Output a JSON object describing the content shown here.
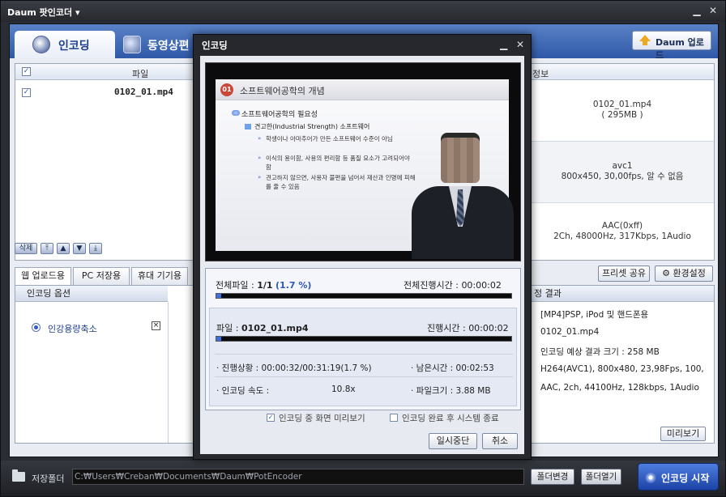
{
  "app": {
    "title": "Daum 팟인코더",
    "title_caret": "▾",
    "min_glyph": "▁",
    "close_glyph": "✕"
  },
  "tabs": {
    "encoding": "인코딩",
    "video_edit": "동영상편"
  },
  "upload_button": "Daum 업로드",
  "file_list": {
    "header_file": "파일",
    "header_info": "정보",
    "row_checked": true,
    "row_file": "0102_01.mp4",
    "info_file_name": "0102_01.mp4",
    "info_file_size": "( 295MB )",
    "info_video_codec": "avc1",
    "info_video_detail": "800x450, 30,00fps, 알 수 없음",
    "info_audio_codec": "AAC(0xff)",
    "info_audio_detail": "2Ch, 48000Hz, 317Kbps, 1Audio",
    "delete_button": "삭제"
  },
  "preset_tabs": [
    "웹 업로드용",
    "PC 저장용",
    "휴대 기기용"
  ],
  "preset_share": "프리셋 공유",
  "settings_button": "환경설정",
  "options_panel": {
    "title": "인코딩 옵션",
    "option_label": "인강용량축소",
    "option_remove": "×"
  },
  "result_panel": {
    "title": "정 결과",
    "lines": [
      "[MP4]PSP, iPod 및 핸드폰용",
      "0102_01.mp4",
      "인코딩 예상 결과 크기 : 258 MB",
      "H264(AVC1), 800x480, 23,98Fps, 100,",
      "AAC, 2ch, 44100Hz, 128kbps, 1Audio"
    ],
    "preview_button": "미리보기"
  },
  "bottom": {
    "folder_label": "저장폴더",
    "path": "C:₩Users₩Creban₩Documents₩Daum₩PotEncoder",
    "change_folder": "폴더변경",
    "open_folder": "폴더열기",
    "start_button": "인코딩 시작"
  },
  "dialog": {
    "title": "인코딩",
    "min_glyph": "▁",
    "close_glyph": "✕",
    "slide": {
      "number": "01",
      "title": "소프트웨어공학의 개념",
      "heading": "소프트웨어공학의 필요성",
      "subheading": "견고한(Industrial Strength) 소프트웨어",
      "bullets": [
        "학생이나 아마추어가 만든 소프트웨어 수준이 아님",
        "이식의 용이함, 사용의 편리함 등 품질 요소가 고려되어야 함",
        "견고하지 않으면, 사용자 불편을 넘어서 재산과 인명에 피해를 줄 수 있음"
      ],
      "bullet_glyph": "»"
    },
    "total_files_label": "전체파일 :",
    "total_files_value": "1/1",
    "total_percent": "(1.7 %)",
    "total_elapsed_label": "전체진행시간 :",
    "total_elapsed_value": "00:00:02",
    "total_progress": 0.017,
    "file_label": "파일 :",
    "file_value": "0102_01.mp4",
    "file_elapsed_label": "진행시간 :",
    "file_elapsed_value": "00:00:02",
    "file_progress": 0.017,
    "status_label": "· 진행상황 :",
    "status_value": "00:00:32/00:31:19(1.7 %)",
    "remaining_label": "· 남은시간 :",
    "remaining_value": "00:02:53",
    "speed_label": "· 인코딩 속도 :",
    "speed_value": "10.8x",
    "file_size_label": "· 파일크기 :",
    "file_size_value": "3.88 MB",
    "preview_during_label": "인코딩 중 화면 미리보기",
    "preview_during_checked": true,
    "shutdown_label": "인코딩 완료 후 시스템 종료",
    "shutdown_checked": false,
    "pause_button": "일시중단",
    "cancel_button": "취소"
  },
  "colors": {
    "accent": "#2f59a8",
    "progress": "#3d6fe0",
    "start_button": "#1b43a5"
  }
}
